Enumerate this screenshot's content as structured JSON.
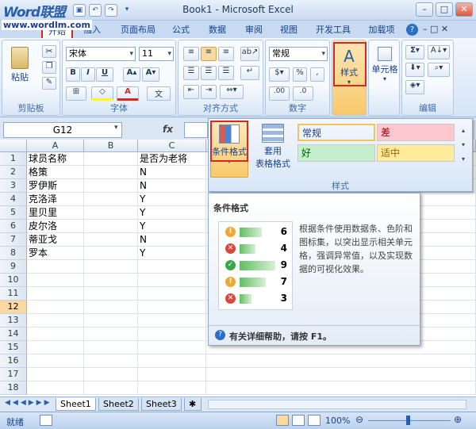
{
  "window": {
    "title": "Book1 - Microsoft Excel"
  },
  "watermark": {
    "logo_text": "Word联盟",
    "url": "www.wordlm.com"
  },
  "tabs": [
    "开始",
    "插入",
    "页面布局",
    "公式",
    "数据",
    "审阅",
    "视图",
    "开发工具",
    "加载项"
  ],
  "active_tab": "开始",
  "ribbon": {
    "clipboard": {
      "label": "剪贴板",
      "paste": "粘贴"
    },
    "font": {
      "label": "字体",
      "name": "宋体",
      "size": "11"
    },
    "alignment": {
      "label": "对齐方式"
    },
    "number": {
      "label": "数字",
      "format": "常规"
    },
    "styles": {
      "label": "样式",
      "button": "样式"
    },
    "cells": {
      "label": "单元格",
      "button": "单元格"
    },
    "editing": {
      "label": "编辑"
    }
  },
  "formula_bar": {
    "name_box": "G12",
    "fx": "fx",
    "value": ""
  },
  "styles_gallery": {
    "conditional_format": "条件格式",
    "table_format": "套用",
    "table_format2": "表格格式",
    "group_label": "样式",
    "items": [
      {
        "label": "常规",
        "bg": "#ffffff",
        "color": "#000000"
      },
      {
        "label": "差",
        "bg": "#ffc7ce",
        "color": "#9c0006"
      },
      {
        "label": "好",
        "bg": "#c6efce",
        "color": "#006100"
      },
      {
        "label": "适中",
        "bg": "#ffeb9c",
        "color": "#9c6500"
      }
    ]
  },
  "tooltip": {
    "title": "条件格式",
    "description": "根据条件使用数据条、色阶和图标集，以突出显示相关单元格，强调异常值，以及实现数据的可视化效果。",
    "help": "有关详细帮助，请按 F1。",
    "sample_rows": [
      {
        "icon": "warning",
        "value": 6,
        "fill": 0.55
      },
      {
        "icon": "error",
        "value": 4,
        "fill": 0.4
      },
      {
        "icon": "ok",
        "value": 9,
        "fill": 0.9
      },
      {
        "icon": "warning",
        "value": 7,
        "fill": 0.65
      },
      {
        "icon": "error",
        "value": 3,
        "fill": 0.3
      }
    ]
  },
  "sheet": {
    "columns": [
      "A",
      "B",
      "C"
    ],
    "rows": [
      "1",
      "2",
      "3",
      "4",
      "5",
      "6",
      "7",
      "8",
      "9",
      "10",
      "11",
      "12",
      "13",
      "14",
      "15",
      "16",
      "17",
      "18"
    ],
    "selected_row": "12",
    "cells": [
      [
        "球员名称",
        "",
        "是否为老将"
      ],
      [
        "格策",
        "",
        "N"
      ],
      [
        "罗伊斯",
        "",
        "N"
      ],
      [
        "克洛泽",
        "",
        "Y"
      ],
      [
        "里贝里",
        "",
        "Y"
      ],
      [
        "皮尔洛",
        "",
        "Y"
      ],
      [
        "蒂亚戈",
        "",
        "N"
      ],
      [
        "罗本",
        "",
        "Y"
      ]
    ]
  },
  "sheet_tabs": [
    "Sheet1",
    "Sheet2",
    "Sheet3"
  ],
  "status": {
    "ready": "就绪",
    "zoom": "100%"
  }
}
